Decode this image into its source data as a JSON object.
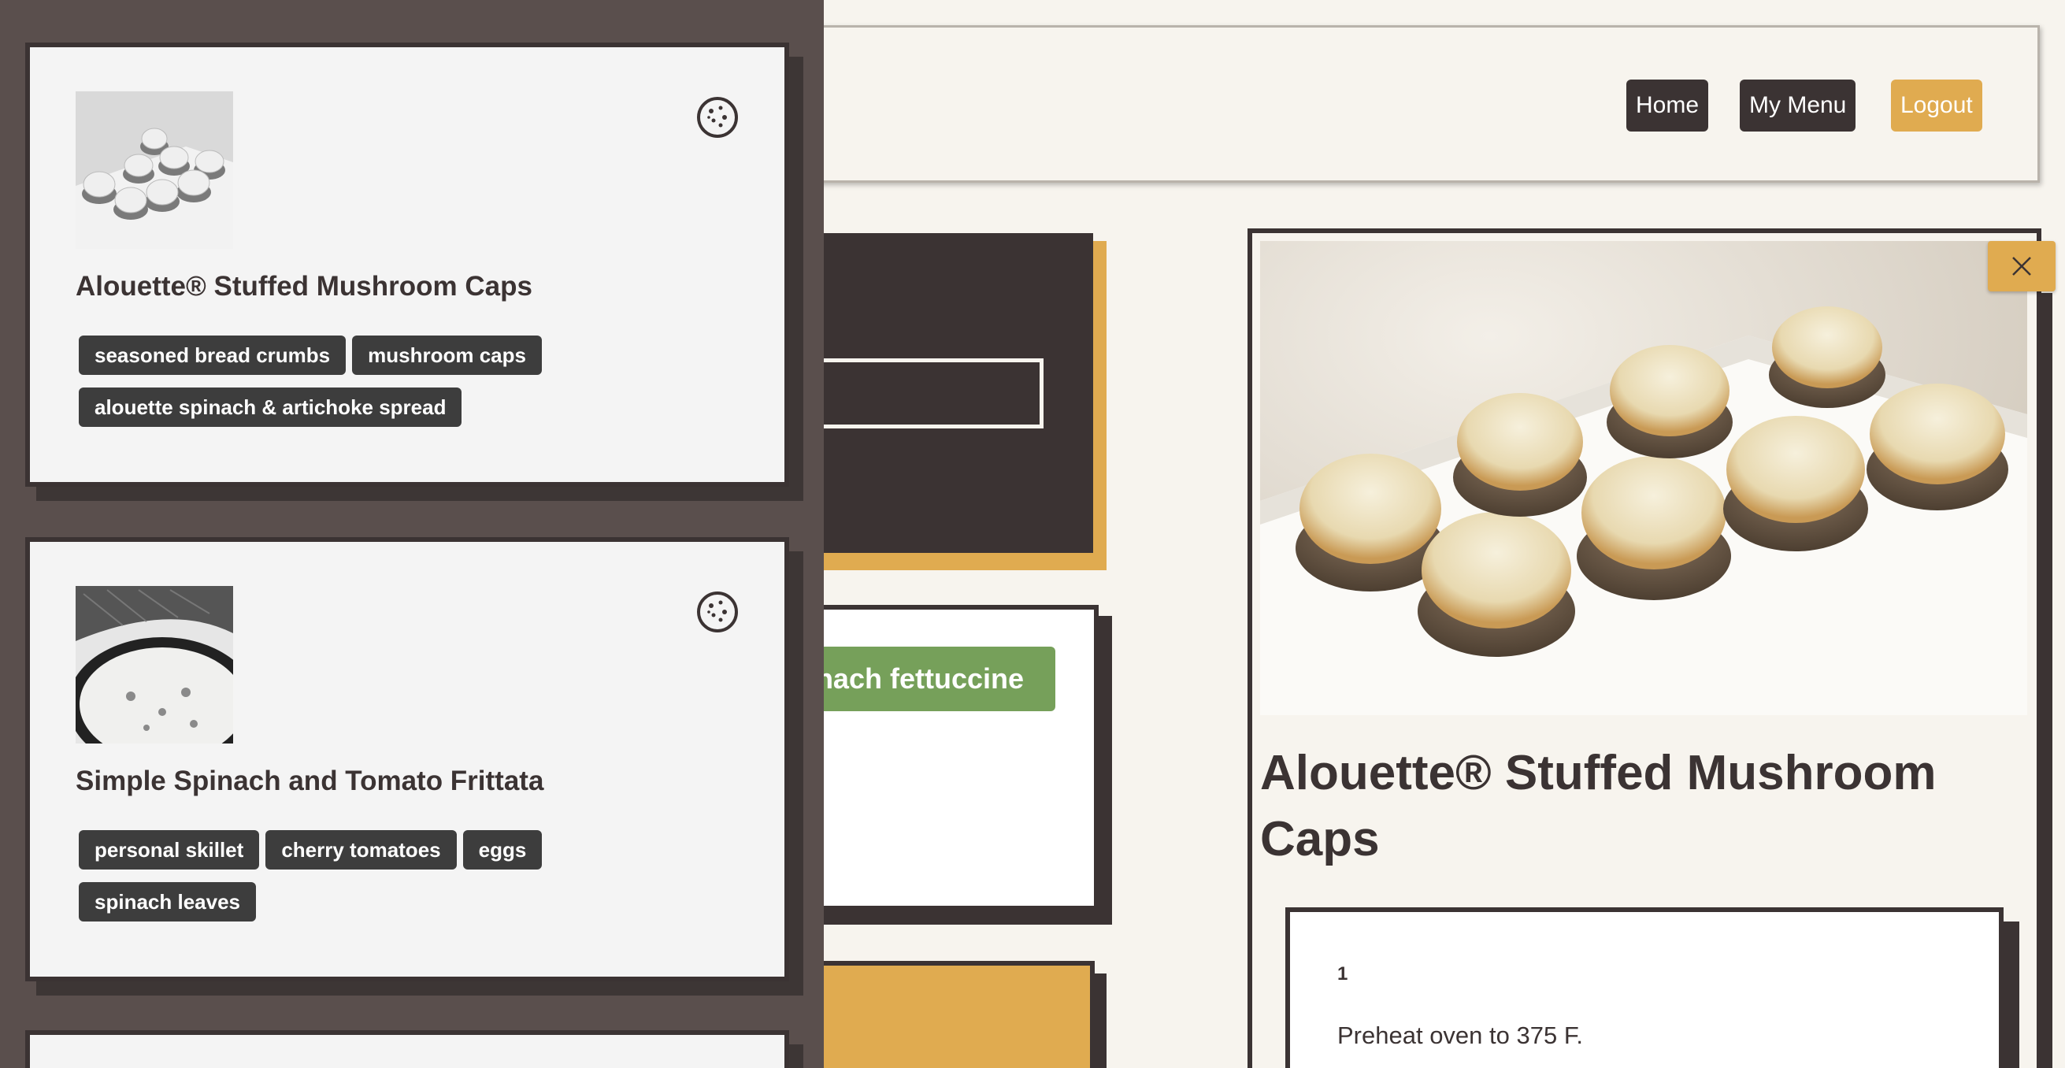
{
  "nav": {
    "home": "Home",
    "my_menu": "My Menu",
    "logout": "Logout",
    "accent_color": "#e0ab50",
    "dark_color": "#3b3333"
  },
  "background": {
    "ingredient_tag": "nach fettuccine"
  },
  "drawer": {
    "cards": [
      {
        "title": "Alouette® Stuffed Mushroom Caps",
        "icon": "cookie-icon",
        "tags": [
          "seasoned bread crumbs",
          "mushroom caps",
          "alouette spinach & artichoke spread"
        ]
      },
      {
        "title": "Simple Spinach and Tomato Frittata",
        "icon": "cookie-icon",
        "tags": [
          "personal skillet",
          "cherry tomatoes",
          "eggs",
          "spinach leaves"
        ]
      }
    ]
  },
  "detail": {
    "title": "Alouette® Stuffed Mushroom Caps",
    "close_icon": "close-icon",
    "steps": [
      {
        "number": "1",
        "text": "Preheat oven to 375 F."
      }
    ]
  }
}
